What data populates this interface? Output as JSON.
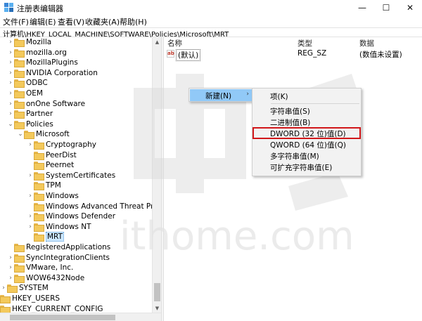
{
  "window": {
    "title": "注册表编辑器",
    "minimize": "—",
    "maximize": "☐",
    "close": "✕"
  },
  "menu": [
    "文件(F)",
    "编辑(E)",
    "查看(V)",
    "收藏夹(A)",
    "帮助(H)"
  ],
  "address": "计算机\\HKEY_LOCAL_MACHINE\\SOFTWARE\\Policies\\Microsoft\\MRT",
  "tree": [
    {
      "label": "Mozilla",
      "chevron": "›"
    },
    {
      "label": "mozilla.org",
      "chevron": "›"
    },
    {
      "label": "MozillaPlugins",
      "chevron": "›"
    },
    {
      "label": "NVIDIA Corporation",
      "chevron": "›"
    },
    {
      "label": "ODBC",
      "chevron": "›"
    },
    {
      "label": "OEM",
      "chevron": "›"
    },
    {
      "label": "onOne Software",
      "chevron": "›"
    },
    {
      "label": "Partner",
      "chevron": "›"
    },
    {
      "label": "Policies",
      "chevron": "⌄"
    },
    {
      "label": "Microsoft",
      "chevron": "⌄"
    },
    {
      "label": "Cryptography",
      "chevron": "›"
    },
    {
      "label": "PeerDist",
      "chevron": ""
    },
    {
      "label": "Peernet",
      "chevron": ""
    },
    {
      "label": "SystemCertificates",
      "chevron": "›"
    },
    {
      "label": "TPM",
      "chevron": ""
    },
    {
      "label": "Windows",
      "chevron": "›"
    },
    {
      "label": "Windows Advanced Threat Protecti",
      "chevron": ""
    },
    {
      "label": "Windows Defender",
      "chevron": "›"
    },
    {
      "label": "Windows NT",
      "chevron": "›"
    },
    {
      "label": "MRT",
      "chevron": ""
    },
    {
      "label": "RegisteredApplications",
      "chevron": ""
    },
    {
      "label": "SyncIntegrationClients",
      "chevron": "›"
    },
    {
      "label": "VMware, Inc.",
      "chevron": "›"
    },
    {
      "label": "WOW6432Node",
      "chevron": "›"
    },
    {
      "label": "SYSTEM",
      "chevron": "›"
    },
    {
      "label": "HKEY_USERS",
      "chevron": "›"
    },
    {
      "label": "HKEY_CURRENT_CONFIG",
      "chevron": "›"
    }
  ],
  "list": {
    "headers": {
      "name": "名称",
      "type": "类型",
      "data": "数据"
    },
    "rows": [
      {
        "icon": "ab",
        "name": "(默认)",
        "type": "REG_SZ",
        "data": "(数值未设置)"
      }
    ]
  },
  "context_menu": {
    "new_label": "新建(N)",
    "arrow": "›",
    "submenu": [
      "项(K)",
      "字符串值(S)",
      "二进制值(B)",
      "DWORD (32 位)值(D)",
      "QWORD (64 位)值(Q)",
      "多字符串值(M)",
      "可扩充字符串值(E)"
    ]
  },
  "colors": {
    "highlight_border": "#d1171a",
    "menu_hover": "#91c9f7",
    "folder": "#f3c95c"
  },
  "watermark": "ithome.com"
}
